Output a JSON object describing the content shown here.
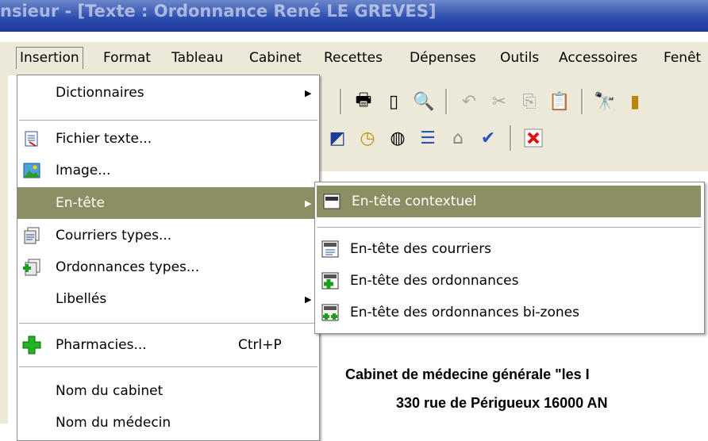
{
  "window": {
    "title": "nsieur - [Texte : Ordonnance René LE GREVES]"
  },
  "menubar": {
    "items": [
      {
        "label": "Insertion",
        "active": true
      },
      {
        "label": "Format"
      },
      {
        "label": "Tableau"
      },
      {
        "label": "Cabinet"
      },
      {
        "label": "Recettes"
      },
      {
        "label": "Dépenses"
      },
      {
        "label": "Outils"
      },
      {
        "label": "Accessoires"
      },
      {
        "label": "Fenêt"
      }
    ]
  },
  "insertion_menu": {
    "items": [
      {
        "label": "Dictionnaires",
        "has_submenu": true,
        "icon": "none"
      },
      {
        "label": "Fichier texte...",
        "icon": "text-file-icon"
      },
      {
        "label": "Image...",
        "icon": "image-icon"
      },
      {
        "label": "En-tête",
        "has_submenu": true,
        "highlighted": true,
        "icon": "none"
      },
      {
        "label": "Courriers types...",
        "icon": "letters-icon"
      },
      {
        "label": "Ordonnances types...",
        "icon": "prescriptions-icon"
      },
      {
        "label": "Libellés",
        "has_submenu": true,
        "icon": "none"
      },
      {
        "label": "Pharmacies...",
        "shortcut": "Ctrl+P",
        "icon": "pharmacy-cross-icon"
      },
      {
        "label": "Nom du cabinet",
        "icon": "none"
      },
      {
        "label": "Nom du médecin",
        "icon": "none"
      }
    ]
  },
  "entete_submenu": {
    "items": [
      {
        "label": "En-tête contextuel",
        "highlighted": true,
        "icon": "header-context-icon"
      },
      {
        "label": "En-tête des courriers",
        "icon": "header-letters-icon"
      },
      {
        "label": "En-tête des ordonnances",
        "icon": "header-prescription-icon"
      },
      {
        "label": "En-tête des ordonnances bi-zones",
        "icon": "header-prescription-bizone-icon"
      }
    ]
  },
  "document": {
    "line1": "Cabinet de médecine générale  \"les I",
    "line2": "330 rue de Périgueux 16000 AN"
  },
  "colors": {
    "highlight": "#8b8f63",
    "menubar": "#ece9d8",
    "titlebar": "#2f4fb0"
  }
}
